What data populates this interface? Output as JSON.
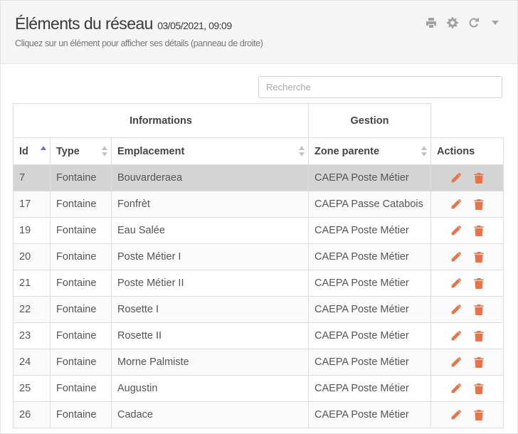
{
  "header": {
    "title": "Éléments du réseau",
    "timestamp": "03/05/2021, 09:09",
    "subtitle": "Cliquez sur un élément pour afficher ses détails (panneau de droite)",
    "tools": [
      "print-icon",
      "gear-icon",
      "refresh-icon",
      "caret-down-icon"
    ]
  },
  "search": {
    "placeholder": "Recherche",
    "value": ""
  },
  "table": {
    "groups": {
      "informations": "Informations",
      "gestion": "Gestion"
    },
    "columns": {
      "id": "Id",
      "type": "Type",
      "location": "Emplacement",
      "zone": "Zone parente",
      "actions": "Actions"
    },
    "sort": {
      "column": "Id",
      "direction": "ascending"
    },
    "rows": [
      {
        "id": "7",
        "type": "Fontaine",
        "location": "Bouvarderaea",
        "zone": "CAEPA Poste Métier",
        "selected": true
      },
      {
        "id": "17",
        "type": "Fontaine",
        "location": "Fonfrèt",
        "zone": "CAEPA Passe Catabois"
      },
      {
        "id": "19",
        "type": "Fontaine",
        "location": "Eau Salée",
        "zone": "CAEPA Poste Métier"
      },
      {
        "id": "20",
        "type": "Fontaine",
        "location": "Poste Métier I",
        "zone": "CAEPA Poste Métier"
      },
      {
        "id": "21",
        "type": "Fontaine",
        "location": "Poste Métier II",
        "zone": "CAEPA Poste Métier"
      },
      {
        "id": "22",
        "type": "Fontaine",
        "location": "Rosette I",
        "zone": "CAEPA Poste Métier"
      },
      {
        "id": "23",
        "type": "Fontaine",
        "location": "Rosette II",
        "zone": "CAEPA Poste Métier"
      },
      {
        "id": "24",
        "type": "Fontaine",
        "location": "Morne Palmiste",
        "zone": "CAEPA Poste Métier"
      },
      {
        "id": "25",
        "type": "Fontaine",
        "location": "Augustin",
        "zone": "CAEPA Poste Métier"
      },
      {
        "id": "26",
        "type": "Fontaine",
        "location": "Cadace",
        "zone": "CAEPA Poste Métier"
      }
    ],
    "row_actions": [
      "pencil-icon",
      "trash-icon"
    ]
  },
  "colors": {
    "action_icon": "#e8734a",
    "sort_active": "#6b76c0",
    "selected_row": "#d4d4d4",
    "header_bg": "#f5f5f5"
  }
}
